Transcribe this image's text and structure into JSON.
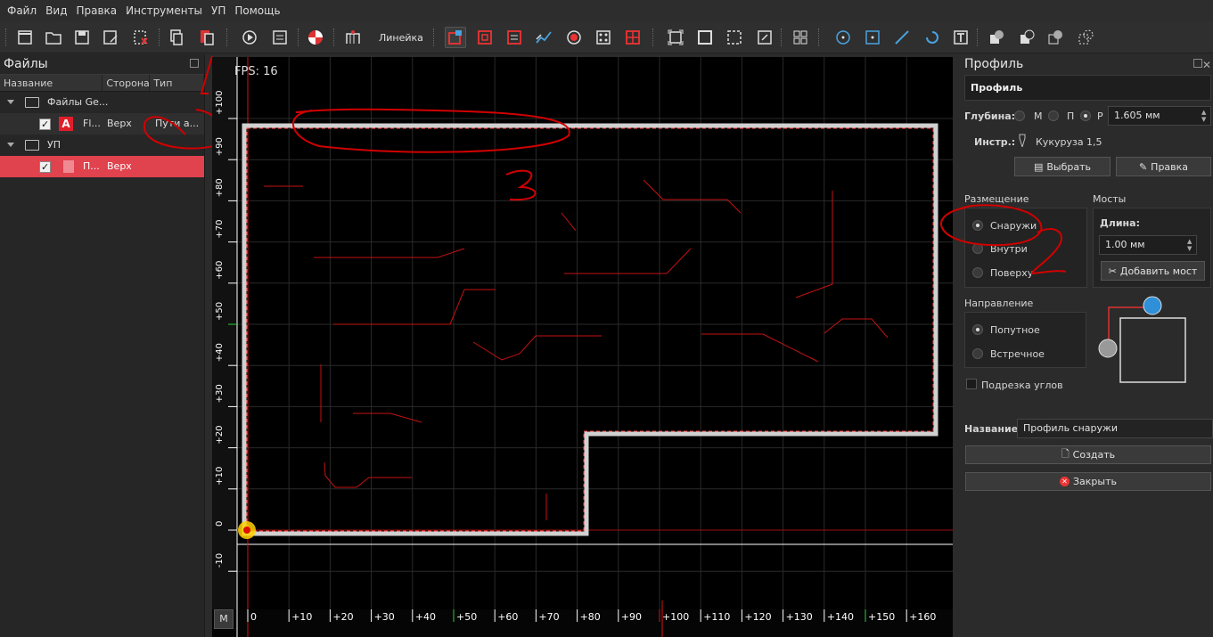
{
  "menu": [
    "Файл",
    "Вид",
    "Правка",
    "Инструменты",
    "УП",
    "Помощь"
  ],
  "toolbar": {
    "ruler_label": "Линейка"
  },
  "files_panel": {
    "title": "Файлы",
    "columns": [
      "Название",
      "Сторона",
      "Тип"
    ],
    "rows": [
      {
        "name": "Файлы Ge...",
        "side": "",
        "type": ""
      },
      {
        "name": "Fl...",
        "side": "Верх",
        "type": "Пути а..."
      },
      {
        "name": "УП",
        "side": "",
        "type": ""
      },
      {
        "name": "П...",
        "side": "Верх",
        "type": ""
      }
    ]
  },
  "canvas": {
    "fps": "FPS: 16",
    "m_button": "M",
    "x_ticks": [
      "0",
      "+10",
      "+20",
      "+30",
      "+40",
      "+50",
      "+60",
      "+70",
      "+80",
      "+90",
      "+100",
      "+110",
      "+120",
      "+130",
      "+140",
      "+150",
      "+160"
    ],
    "y_ticks": [
      "0",
      "+10",
      "+20",
      "+30",
      "+40",
      "+50",
      "+60",
      "+70",
      "+80",
      "+90",
      "+100",
      "-10"
    ],
    "annotations": [
      "1",
      "2",
      "3"
    ]
  },
  "profile_panel": {
    "title": "Профиль",
    "header": "Профиль",
    "depth_label": "Глубина:",
    "depth_options": [
      "М",
      "П",
      "Р"
    ],
    "depth_selected": "Р",
    "depth_value": "1.605 мм",
    "tool_label": "Инстр.:",
    "tool_value": "Кукуруза 1,5",
    "select_button": "Выбрать",
    "edit_button": "Правка",
    "placement_label": "Размещение",
    "placement_options": [
      "Снаружи",
      "Внутри",
      "Поверху"
    ],
    "placement_selected": "Снаружи",
    "bridges_label": "Мосты",
    "length_label": "Длина:",
    "length_value": "1.00 мм",
    "add_bridge_button": "Добавить мост",
    "direction_label": "Направление",
    "direction_options": [
      "Попутное",
      "Встречное"
    ],
    "direction_selected": "Попутное",
    "corner_trim_label": "Подрезка углов",
    "name_label": "Название:",
    "name_value": "Профиль снаружи",
    "create_button": "Создать",
    "close_button": "Закрыть"
  },
  "colors": {
    "accent_red": "#e0424e",
    "canvas_bg": "#000000",
    "profile_line": "#ff2a2a"
  }
}
